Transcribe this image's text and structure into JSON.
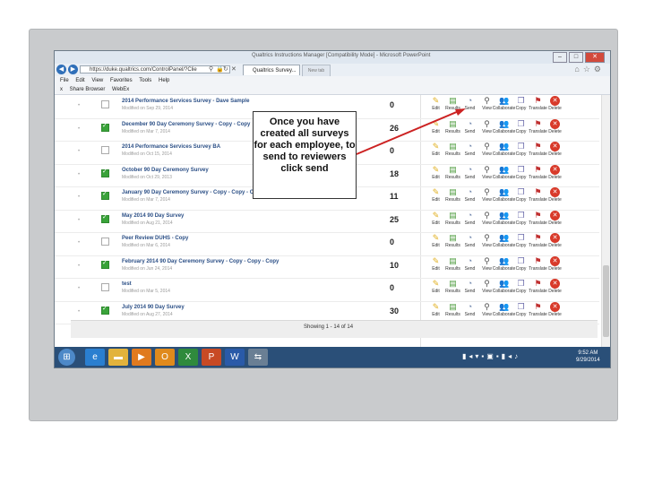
{
  "browser": {
    "window_title": "Qualtrics Instructions Manager [Compatibility Mode] - Microsoft PowerPoint",
    "address": "https://duke.qualtrics.com/ControlPanel/?Clie",
    "tab_active": "Qualtrics Survey...",
    "tab_new": "New tab",
    "menu": [
      "File",
      "Edit",
      "View",
      "Favorites",
      "Tools",
      "Help"
    ],
    "fav_items": [
      "x",
      "Share Browser",
      "WebEx"
    ]
  },
  "surveys": [
    {
      "name": "2014 Performance Services Survey - Dave Sample",
      "modified": "Modified on Sep 29, 2014",
      "responses": "0",
      "checked": false
    },
    {
      "name": "December 90 Day Ceremony Survey - Copy - Copy",
      "modified": "Modified on Mar 7, 2014",
      "responses": "26",
      "checked": true
    },
    {
      "name": "2014 Performance Services Survey BA",
      "modified": "Modified on Oct 15, 2014",
      "responses": "0",
      "checked": false
    },
    {
      "name": "October 90 Day Ceremony Survey",
      "modified": "Modified on Oct 29, 2013",
      "responses": "18",
      "checked": true
    },
    {
      "name": "January 90 Day Ceremony Survey - Copy - Copy - Copy",
      "modified": "Modified on Mar 7, 2014",
      "responses": "11",
      "checked": true
    },
    {
      "name": "May 2014 90 Day Survey",
      "modified": "Modified on Aug 21, 2014",
      "responses": "25",
      "checked": true
    },
    {
      "name": "Peer Review DUHS - Copy",
      "modified": "Modified on Mar 6, 2014",
      "responses": "0",
      "checked": false
    },
    {
      "name": "February 2014 90 Day Ceremony Survey - Copy - Copy - Copy",
      "modified": "Modified on Jun 24, 2014",
      "responses": "10",
      "checked": true
    },
    {
      "name": "test",
      "modified": "Modified on Mar 5, 2014",
      "responses": "0",
      "checked": false
    },
    {
      "name": "July 2014 90 Day Survey",
      "modified": "Modified on Aug 27, 2014",
      "responses": "30",
      "checked": true
    }
  ],
  "actions": [
    {
      "label": "Edit",
      "icon": "pencil-icon",
      "glyph": "✎",
      "cls": "edit"
    },
    {
      "label": "Results",
      "icon": "results-chart-icon",
      "glyph": "▤",
      "cls": "results"
    },
    {
      "label": "Send",
      "icon": "send-icon",
      "glyph": "◔",
      "cls": "send"
    },
    {
      "label": "View",
      "icon": "magnifier-icon",
      "glyph": "⚲",
      "cls": "view"
    },
    {
      "label": "Collaborate",
      "icon": "collaborate-icon",
      "glyph": "👥",
      "cls": "collab"
    },
    {
      "label": "Copy",
      "icon": "copy-icon",
      "glyph": "❐",
      "cls": "copy"
    },
    {
      "label": "Translate",
      "icon": "translate-flag-icon",
      "glyph": "⚑",
      "cls": "translate"
    },
    {
      "label": "Delete",
      "icon": "delete-icon",
      "glyph": "✕",
      "cls": "delete"
    }
  ],
  "footer_text": "Showing 1 - 14 of 14",
  "taskbar": {
    "apps": [
      {
        "name": "ie-icon",
        "glyph": "e",
        "color": "#2a7fd0"
      },
      {
        "name": "folder-icon",
        "glyph": "▬",
        "color": "#e2b33c"
      },
      {
        "name": "media-player-icon",
        "glyph": "▶",
        "color": "#e07a1e"
      },
      {
        "name": "outlook-icon",
        "glyph": "O",
        "color": "#e08a1c"
      },
      {
        "name": "excel-icon",
        "glyph": "X",
        "color": "#2f8a3c"
      },
      {
        "name": "powerpoint-icon",
        "glyph": "P",
        "color": "#c84a24"
      },
      {
        "name": "word-icon",
        "glyph": "W",
        "color": "#2a5aa8"
      },
      {
        "name": "remote-icon",
        "glyph": "⇆",
        "color": "#6a7f94"
      }
    ],
    "time": "9:52 AM",
    "date": "9/29/2014"
  },
  "callout": {
    "text": "Once you have created all surveys for each employee, to send to reviewers click send"
  },
  "colors": {
    "arrow": "#cc2222",
    "checked": "#3aa33a",
    "link": "#2b4f86"
  }
}
